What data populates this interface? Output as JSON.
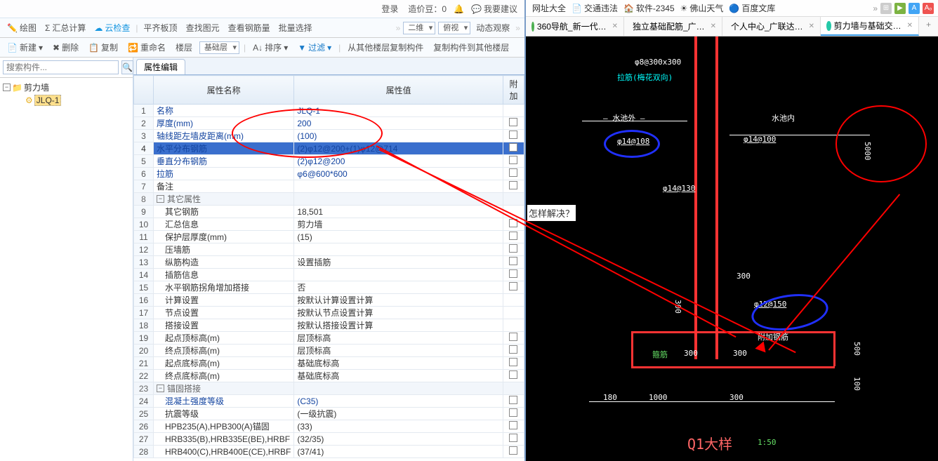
{
  "top_right_bar": {
    "login": "登录",
    "credit_label": "造价豆：0",
    "suggest": "我要建议"
  },
  "toolbar1": {
    "draw": "绘图",
    "summary": "汇总计算",
    "cloud": "云检查",
    "align_top": "平齐板顶",
    "find_elem": "查找图元",
    "view_rebar": "查看钢筋量",
    "batch_select": "批量选择",
    "view2d": "二维",
    "top_view": "俯视",
    "motion": "动态观察"
  },
  "toolbar2": {
    "new": "新建",
    "delete": "删除",
    "copy": "复制",
    "rename": "重命名",
    "floor": "楼层",
    "base_floor": "基础层",
    "sort": "排序",
    "filter": "过滤",
    "copy_from_other": "从其他楼层复制构件",
    "copy_to_other": "复制构件到其他楼层"
  },
  "search_placeholder": "搜索构件...",
  "tree": {
    "root": "剪力墙",
    "child": "JLQ-1"
  },
  "prop_tab": "属性编辑",
  "prop_headers": {
    "name": "属性名称",
    "value": "属性值",
    "extra": "附加"
  },
  "props": [
    {
      "n": 1,
      "name": "名称",
      "val": "JLQ-1",
      "blue": true
    },
    {
      "n": 2,
      "name": "厚度(mm)",
      "val": "200",
      "blue": true,
      "chk": true
    },
    {
      "n": 3,
      "name": "轴线距左墙皮距离(mm)",
      "val": "(100)",
      "blue": true,
      "chk": true
    },
    {
      "n": 4,
      "name": "水平分布钢筋",
      "val": "(2)φ12@200+(1)φ12@714",
      "blue": true,
      "sel": true,
      "chk": true
    },
    {
      "n": 5,
      "name": "垂直分布钢筋",
      "val": "(2)φ12@200",
      "blue": true,
      "chk": true
    },
    {
      "n": 6,
      "name": "拉筋",
      "val": "φ6@600*600",
      "blue": true,
      "chk": true
    },
    {
      "n": 7,
      "name": "备注",
      "val": "",
      "chk": true
    },
    {
      "n": 8,
      "group": true,
      "name": "其它属性"
    },
    {
      "n": 9,
      "name": "其它钢筋",
      "val": "18,501",
      "indent": true
    },
    {
      "n": 10,
      "name": "汇总信息",
      "val": "剪力墙",
      "indent": true,
      "chk": true
    },
    {
      "n": 11,
      "name": "保护层厚度(mm)",
      "val": "(15)",
      "indent": true,
      "chk": true
    },
    {
      "n": 12,
      "name": "压墙筋",
      "val": "",
      "indent": true,
      "chk": true
    },
    {
      "n": 13,
      "name": "纵筋构造",
      "val": "设置插筋",
      "indent": true,
      "chk": true
    },
    {
      "n": 14,
      "name": "插筋信息",
      "val": "",
      "indent": true,
      "chk": true
    },
    {
      "n": 15,
      "name": "水平钢筋拐角增加搭接",
      "val": "否",
      "indent": true,
      "chk": true
    },
    {
      "n": 16,
      "name": "计算设置",
      "val": "按默认计算设置计算",
      "indent": true
    },
    {
      "n": 17,
      "name": "节点设置",
      "val": "按默认节点设置计算",
      "indent": true
    },
    {
      "n": 18,
      "name": "搭接设置",
      "val": "按默认搭接设置计算",
      "indent": true
    },
    {
      "n": 19,
      "name": "起点顶标高(m)",
      "val": "层顶标高",
      "indent": true,
      "chk": true
    },
    {
      "n": 20,
      "name": "终点顶标高(m)",
      "val": "层顶标高",
      "indent": true,
      "chk": true
    },
    {
      "n": 21,
      "name": "起点底标高(m)",
      "val": "基础底标高",
      "indent": true,
      "chk": true
    },
    {
      "n": 22,
      "name": "终点底标高(m)",
      "val": "基础底标高",
      "indent": true,
      "chk": true
    },
    {
      "n": 23,
      "group": true,
      "name": "锚固搭接"
    },
    {
      "n": 24,
      "name": "混凝土强度等级",
      "val": "(C35)",
      "blue": true,
      "indent": true,
      "chk": true
    },
    {
      "n": 25,
      "name": "抗震等级",
      "val": "(一级抗震)",
      "indent": true,
      "chk": true
    },
    {
      "n": 26,
      "name": "HPB235(A),HPB300(A)锚固",
      "val": "(33)",
      "indent": true,
      "chk": true
    },
    {
      "n": 27,
      "name": "HRB335(B),HRB335E(BE),HRBF",
      "val": "(32/35)",
      "indent": true,
      "chk": true
    },
    {
      "n": 28,
      "name": "HRB400(C),HRB400E(CE),HRBF",
      "val": "(37/41)",
      "indent": true,
      "chk": true
    }
  ],
  "browser_links": {
    "web_all": "网址大全",
    "traffic": "交通违法",
    "soft2345": "软件-2345",
    "foshan_weather": "佛山天气",
    "baidu_wenku": "百度文库"
  },
  "tabs": [
    {
      "label": "360导航_新一代…",
      "color": "green"
    },
    {
      "label": "独立基础配筋_广…",
      "color": "teal"
    },
    {
      "label": "个人中心_广联达…",
      "color": "orange"
    },
    {
      "label": "剪力墙与基础交…",
      "color": "teal",
      "active": true
    }
  ],
  "question_text": "怎样解决？",
  "cad": {
    "top_dim": "φ8@300x300",
    "stirrup": "拉筋(梅花双向)",
    "pool_out": "水池外",
    "pool_in": "水池内",
    "left_rebar": "φ14@108",
    "right_rebar": "φ14@100",
    "height": "5000",
    "mid_rebar": "φ14@130",
    "d300a": "300",
    "d300b": "300",
    "d300c": "300",
    "d300d": "300",
    "d12_150": "φ12@150",
    "extra_rebar": "附加钢筋",
    "stirrup_b": "箍筋",
    "h500": "500",
    "h100": "100",
    "b180": "180",
    "b1000": "1000",
    "b300": "300",
    "title": "Q1大样",
    "scale": "1:50"
  }
}
